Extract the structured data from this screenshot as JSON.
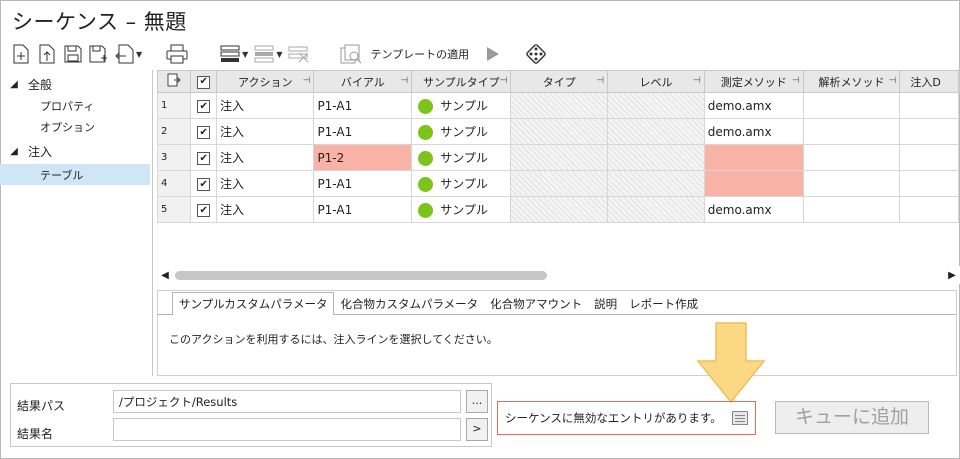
{
  "window": {
    "title": "シーケンス – 無題"
  },
  "toolbar": {
    "icons": [
      "new-file-icon",
      "upload-icon",
      "save-icon",
      "save-as-icon",
      "export-icon",
      "print-icon",
      "insert-row-icon",
      "delete-row-icon",
      "clear-icon",
      "template-icon",
      "play-icon",
      "dice-icon"
    ],
    "template_label": "テンプレートの適用"
  },
  "tree": {
    "group1": "全般",
    "item_properties": "プロパティ",
    "item_options": "オプション",
    "group2": "注入",
    "item_table": "テーブル"
  },
  "grid": {
    "columns": [
      "アクション",
      "バイアル",
      "サンプルタイプ",
      "タイプ",
      "レベル",
      "測定メソッド",
      "解析メソッド",
      "注入D"
    ],
    "rows": [
      {
        "num": "1",
        "action": "注入",
        "vial": "P1-A1",
        "sample_type": "サンプル",
        "type": "",
        "level": "",
        "method": "demo.amx",
        "analysis": "",
        "inj": ""
      },
      {
        "num": "2",
        "action": "注入",
        "vial": "P1-A1",
        "sample_type": "サンプル",
        "type": "",
        "level": "",
        "method": "demo.amx",
        "analysis": "",
        "inj": ""
      },
      {
        "num": "3",
        "action": "注入",
        "vial": "P1-2",
        "sample_type": "サンプル",
        "type": "",
        "level": "",
        "method": "",
        "analysis": "",
        "inj": ""
      },
      {
        "num": "4",
        "action": "注入",
        "vial": "P1-A1",
        "sample_type": "サンプル",
        "type": "",
        "level": "",
        "method": "",
        "analysis": "",
        "inj": ""
      },
      {
        "num": "5",
        "action": "注入",
        "vial": "P1-A1",
        "sample_type": "サンプル",
        "type": "",
        "level": "",
        "method": "demo.amx",
        "analysis": "",
        "inj": ""
      }
    ],
    "error_color": "#f9b3a6",
    "sample_dot_color": "#7cc31c"
  },
  "tabs": {
    "items": [
      "サンプルカスタムパラメータ",
      "化合物カスタムパラメータ",
      "化合物アマウント",
      "説明",
      "レポート作成"
    ],
    "message": "このアクションを利用するには、注入ラインを選択してください。"
  },
  "bottom": {
    "result_path_label": "結果パス",
    "result_path_value": "/プロジェクト/Results",
    "browse_label": "...",
    "result_name_label": "結果名",
    "result_name_value": "",
    "next_label": ">"
  },
  "status": {
    "message": "シーケンスに無効なエントリがあります。"
  },
  "queue_button": {
    "label": "キューに追加"
  },
  "accent_arrow_color": "#f8d47a"
}
